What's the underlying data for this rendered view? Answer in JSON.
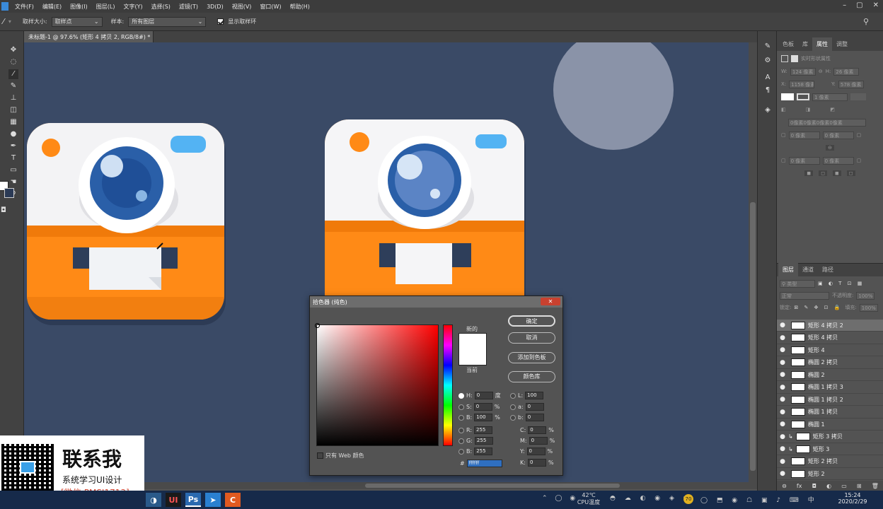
{
  "menu": [
    "文件(F)",
    "编辑(E)",
    "图像(I)",
    "图层(L)",
    "文字(Y)",
    "选择(S)",
    "滤镜(T)",
    "3D(D)",
    "视图(V)",
    "窗口(W)",
    "帮助(H)"
  ],
  "options": {
    "sample_size_label": "取样大小:",
    "sample_size_value": "取样点",
    "sample_label": "样本:",
    "sample_value": "所有图层",
    "show_ring_label": "显示取样环"
  },
  "doc_tab": "未标题-1 @ 97.6% (矩形 4 拷贝 2, RGB/8#) *",
  "panel_tabs": [
    "色板",
    "库",
    "属性",
    "调整"
  ],
  "properties": {
    "title": "实时形状属性",
    "w_label": "W:",
    "w_value": "124 像素",
    "h_label": "H:",
    "h_value": "26 像素",
    "x_label": "X:",
    "x_value": "1158 像素",
    "y_label": "Y:",
    "y_value": "578 像素",
    "stroke_width": "1 像素",
    "radius_all": "0像素0像素0像素0像素",
    "radius_a": "0 像素",
    "radius_b": "0 像素",
    "radius_c": "0 像素",
    "radius_d": "0 像素"
  },
  "layers_panel": {
    "tabs": [
      "图层",
      "通道",
      "路径"
    ],
    "kind": "类型",
    "blend": "正常",
    "opacity_label": "不透明度:",
    "opacity": "100%",
    "lock_label": "锁定:",
    "fill_label": "填充:",
    "fill": "100%",
    "items": [
      {
        "name": "矩形 4 拷贝 2",
        "selected": true,
        "clip": false
      },
      {
        "name": "矩形 4 拷贝",
        "selected": false,
        "clip": false
      },
      {
        "name": "矩形 4",
        "selected": false,
        "clip": false
      },
      {
        "name": "椭圆 2 拷贝",
        "selected": false,
        "clip": false
      },
      {
        "name": "椭圆 2",
        "selected": false,
        "clip": false
      },
      {
        "name": "椭圆 1 拷贝 3",
        "selected": false,
        "clip": false
      },
      {
        "name": "椭圆 1 拷贝 2",
        "selected": false,
        "clip": false
      },
      {
        "name": "椭圆 1 拷贝",
        "selected": false,
        "clip": false
      },
      {
        "name": "椭圆 1",
        "selected": false,
        "clip": false
      },
      {
        "name": "矩形 3 拷贝",
        "selected": false,
        "clip": true
      },
      {
        "name": "矩形 3",
        "selected": false,
        "clip": true
      },
      {
        "name": "矩形 2 拷贝",
        "selected": false,
        "clip": false
      },
      {
        "name": "矩形 2",
        "selected": false,
        "clip": false
      }
    ]
  },
  "color_picker": {
    "title": "拾色器 (纯色)",
    "new_label": "新的",
    "current_label": "当前",
    "ok": "确定",
    "cancel": "取消",
    "add_swatch": "添加到色板",
    "color_lib": "颜色库",
    "web_only": "只有 Web 颜色",
    "hash": "#",
    "hex": "ffffff",
    "h_label": "H:",
    "h": "0",
    "h_unit": "度",
    "s_label": "S:",
    "s": "0",
    "s_unit": "%",
    "b_label": "B:",
    "b": "100",
    "b_unit": "%",
    "r_label": "R:",
    "r": "255",
    "g_label": "G:",
    "g": "255",
    "bb_label": "B:",
    "bb": "255",
    "l_label": "L:",
    "l": "100",
    "a_label": "a:",
    "a": "0",
    "b2_label": "b:",
    "b2": "0",
    "c_label": "C:",
    "c": "0",
    "c_unit": "%",
    "m_label": "M:",
    "m": "0",
    "m_unit": "%",
    "y_label": "Y:",
    "y": "0",
    "y_unit": "%",
    "k_label": "K:",
    "k": "0",
    "k_unit": "%"
  },
  "overlay": {
    "title": "联系我",
    "subtitle": "系统学习UI设计",
    "wechat": "[微信:PMSJ1713]"
  },
  "taskbar": {
    "temp": "42℃",
    "cpu": "CPU温度",
    "time": "15:24",
    "date": "2020/2/29",
    "badge": "70"
  },
  "colors": {
    "canvas_bg": "#3a4a66",
    "orange": "#ff8a16",
    "lens_blue": "#2a5fa8",
    "badge_blue": "#53b3f3",
    "moon": "#8a93a8"
  }
}
